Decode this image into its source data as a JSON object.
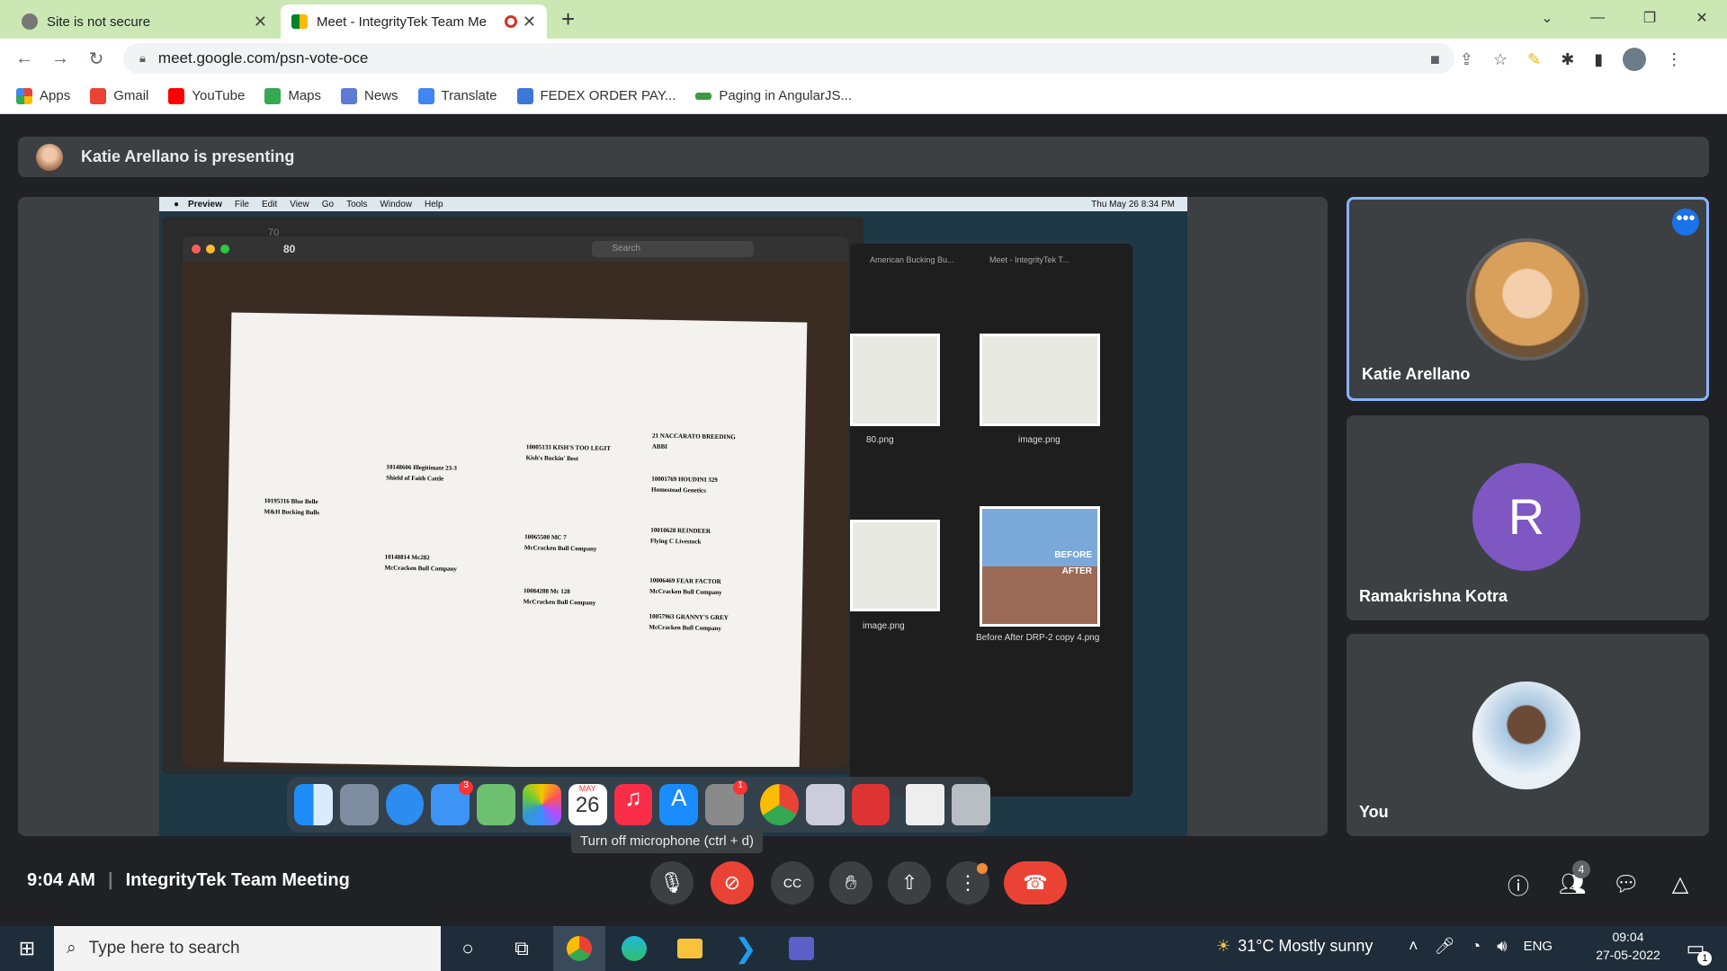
{
  "tabs": [
    {
      "label": "Site is not secure"
    },
    {
      "label": "Meet - IntegrityTek Team Me"
    }
  ],
  "url": "meet.google.com/psn-vote-oce",
  "bookmarks": [
    {
      "label": "Apps",
      "color": "#4285f4"
    },
    {
      "label": "Gmail",
      "color": "#ea4335"
    },
    {
      "label": "YouTube",
      "color": "#ff0000"
    },
    {
      "label": "Maps",
      "color": "#34a853"
    },
    {
      "label": "News",
      "color": "#5b7bd5"
    },
    {
      "label": "Translate",
      "color": "#4285f4"
    },
    {
      "label": "FEDEX ORDER PAY...",
      "color": "#3c78d8"
    },
    {
      "label": "Paging in AngularJS...",
      "color": "#3c9a3c"
    }
  ],
  "presenting": "Katie Arellano is presenting",
  "shared": {
    "menubar": [
      "Preview",
      "File",
      "Edit",
      "View",
      "Go",
      "Tools",
      "Window",
      "Help"
    ],
    "clock": "Thu May 26  8:34 PM",
    "zoom_front": "80",
    "zoom_back": "70",
    "search": "Search",
    "tab1": "American Bucking Bu...",
    "tab2": "Meet - IntegrityTek T...",
    "thumbs": [
      "80.png",
      "image.png",
      "image.png",
      "Before After DRP-2 copy 4.png"
    ],
    "before": "BEFORE",
    "after": "AFTER",
    "dock_date_month": "MAY",
    "dock_date_day": "26",
    "mail_badge": "3",
    "settings_badge": "1",
    "pedigree": [
      "10005133  KISH'S TOO LEGIT",
      "Kish's Buckin' Best",
      "10148606  Illegitimate 23-3",
      "Shield of Faith Cattle",
      "10195316  Blue Belle",
      "M&H Bucking Bulls",
      "10148814  Mc282",
      "McCracken Bull Company",
      "10065500  MC 7",
      "McCracken Bull Company",
      "10084288  Mc 128",
      "McCracken Bull Company",
      "21  NACCARATO BREEDING",
      "ABBI",
      "10001769 HOUDINI 329",
      "Homestead Genetics",
      "10010628 REINDEER",
      "Flying C Livestock",
      "10006469 FEAR FACTOR",
      "McCracken Bull Company",
      "10057963 GRANNY'S GREY",
      "McCracken Bull Company"
    ]
  },
  "participants": [
    {
      "name": "Katie Arellano"
    },
    {
      "name": "Ramakrishna Kotra",
      "initial": "R"
    },
    {
      "name": "You"
    }
  ],
  "tooltip": "Turn off microphone (ctrl + d)",
  "time": "9:04 AM",
  "meeting": "IntegrityTek Team Meeting",
  "people_count": "4",
  "taskbar": {
    "search": "Type here to search",
    "weather": "31°C  Mostly sunny",
    "lang": "ENG",
    "clock_time": "09:04",
    "clock_date": "27-05-2022",
    "notif": "1"
  }
}
